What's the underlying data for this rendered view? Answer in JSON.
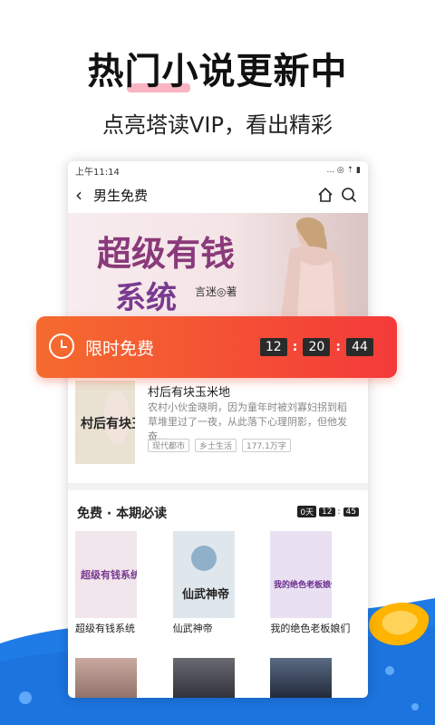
{
  "headline": "热门小说更新中",
  "subline": "点亮塔读VIP，看出精彩",
  "phone": {
    "status_time": "上午11:14",
    "status_icons": "... ◎ ⇡ ▮",
    "topbar_title": "男生免费",
    "banner": {
      "title_line1": "超级有钱",
      "title_line2": "系统",
      "author": "言迷◎著"
    },
    "book": {
      "name": "村后有块玉米地",
      "desc": "农村小伙金晓明，因为童年时被刘寡妇拐到稻草堆里过了一夜，从此落下心理阴影，但他发奋…",
      "tags": [
        "现代都市",
        "乡土生活",
        "177.1万字"
      ],
      "cover_title": "村后有块玉米地"
    },
    "section": {
      "title": "免费 · 本期必读",
      "timer_days": "0天",
      "timer_h": "12",
      "timer_m": "45"
    },
    "grid": [
      {
        "name": "超级有钱系统",
        "cover_text": "超级有钱系统"
      },
      {
        "name": "仙武神帝",
        "cover_text": "仙武神帝"
      },
      {
        "name": "我的绝色老板娘们",
        "cover_text": "我的绝色老板娘们"
      }
    ]
  },
  "free_bar": {
    "label": "限时免费",
    "hours": "12",
    "minutes": "20",
    "seconds": "44"
  },
  "colors": {
    "accent": "#f4523a",
    "wave": "#1f7be6"
  }
}
